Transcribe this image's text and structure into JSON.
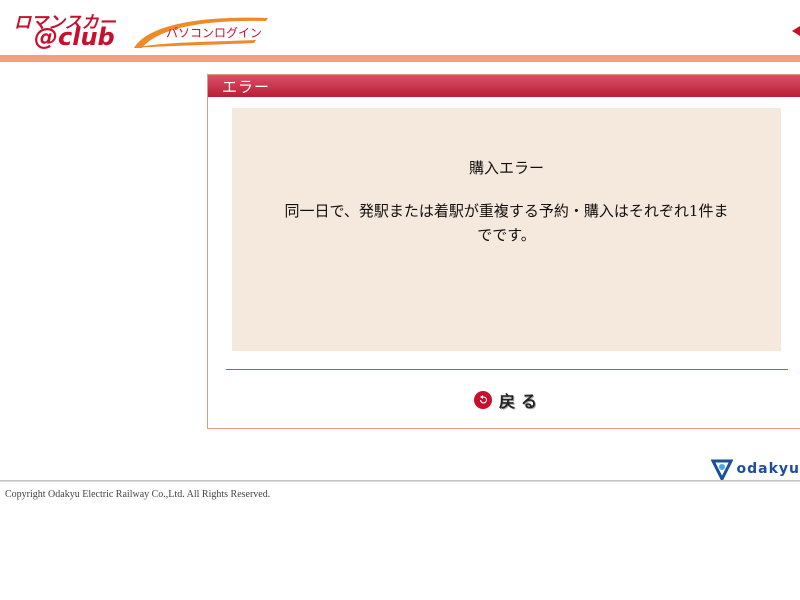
{
  "header": {
    "brand_top": "ロマンスカー",
    "brand_bottom": "@club",
    "login_label": "パソコンログイン"
  },
  "panel": {
    "title": "エラー",
    "error_heading": "購入エラー",
    "error_message": "同一日で、発駅または着駅が重複する予約・購入はそれぞれ1件までです。",
    "back_label": "戻る"
  },
  "footer": {
    "company_logo_text": "odakyu",
    "copyright": "Copyright Odakyu Electric Railway Co.,Ltd. All Rights Reserved."
  },
  "colors": {
    "brand_red": "#c8102e",
    "accent_orange": "#f4a07c",
    "message_bg": "#f5e8dd",
    "odakyu_blue": "#1a4f9c"
  },
  "icons": {
    "back": "back-arrow-icon",
    "footer": "odakyu-logo-icon"
  }
}
